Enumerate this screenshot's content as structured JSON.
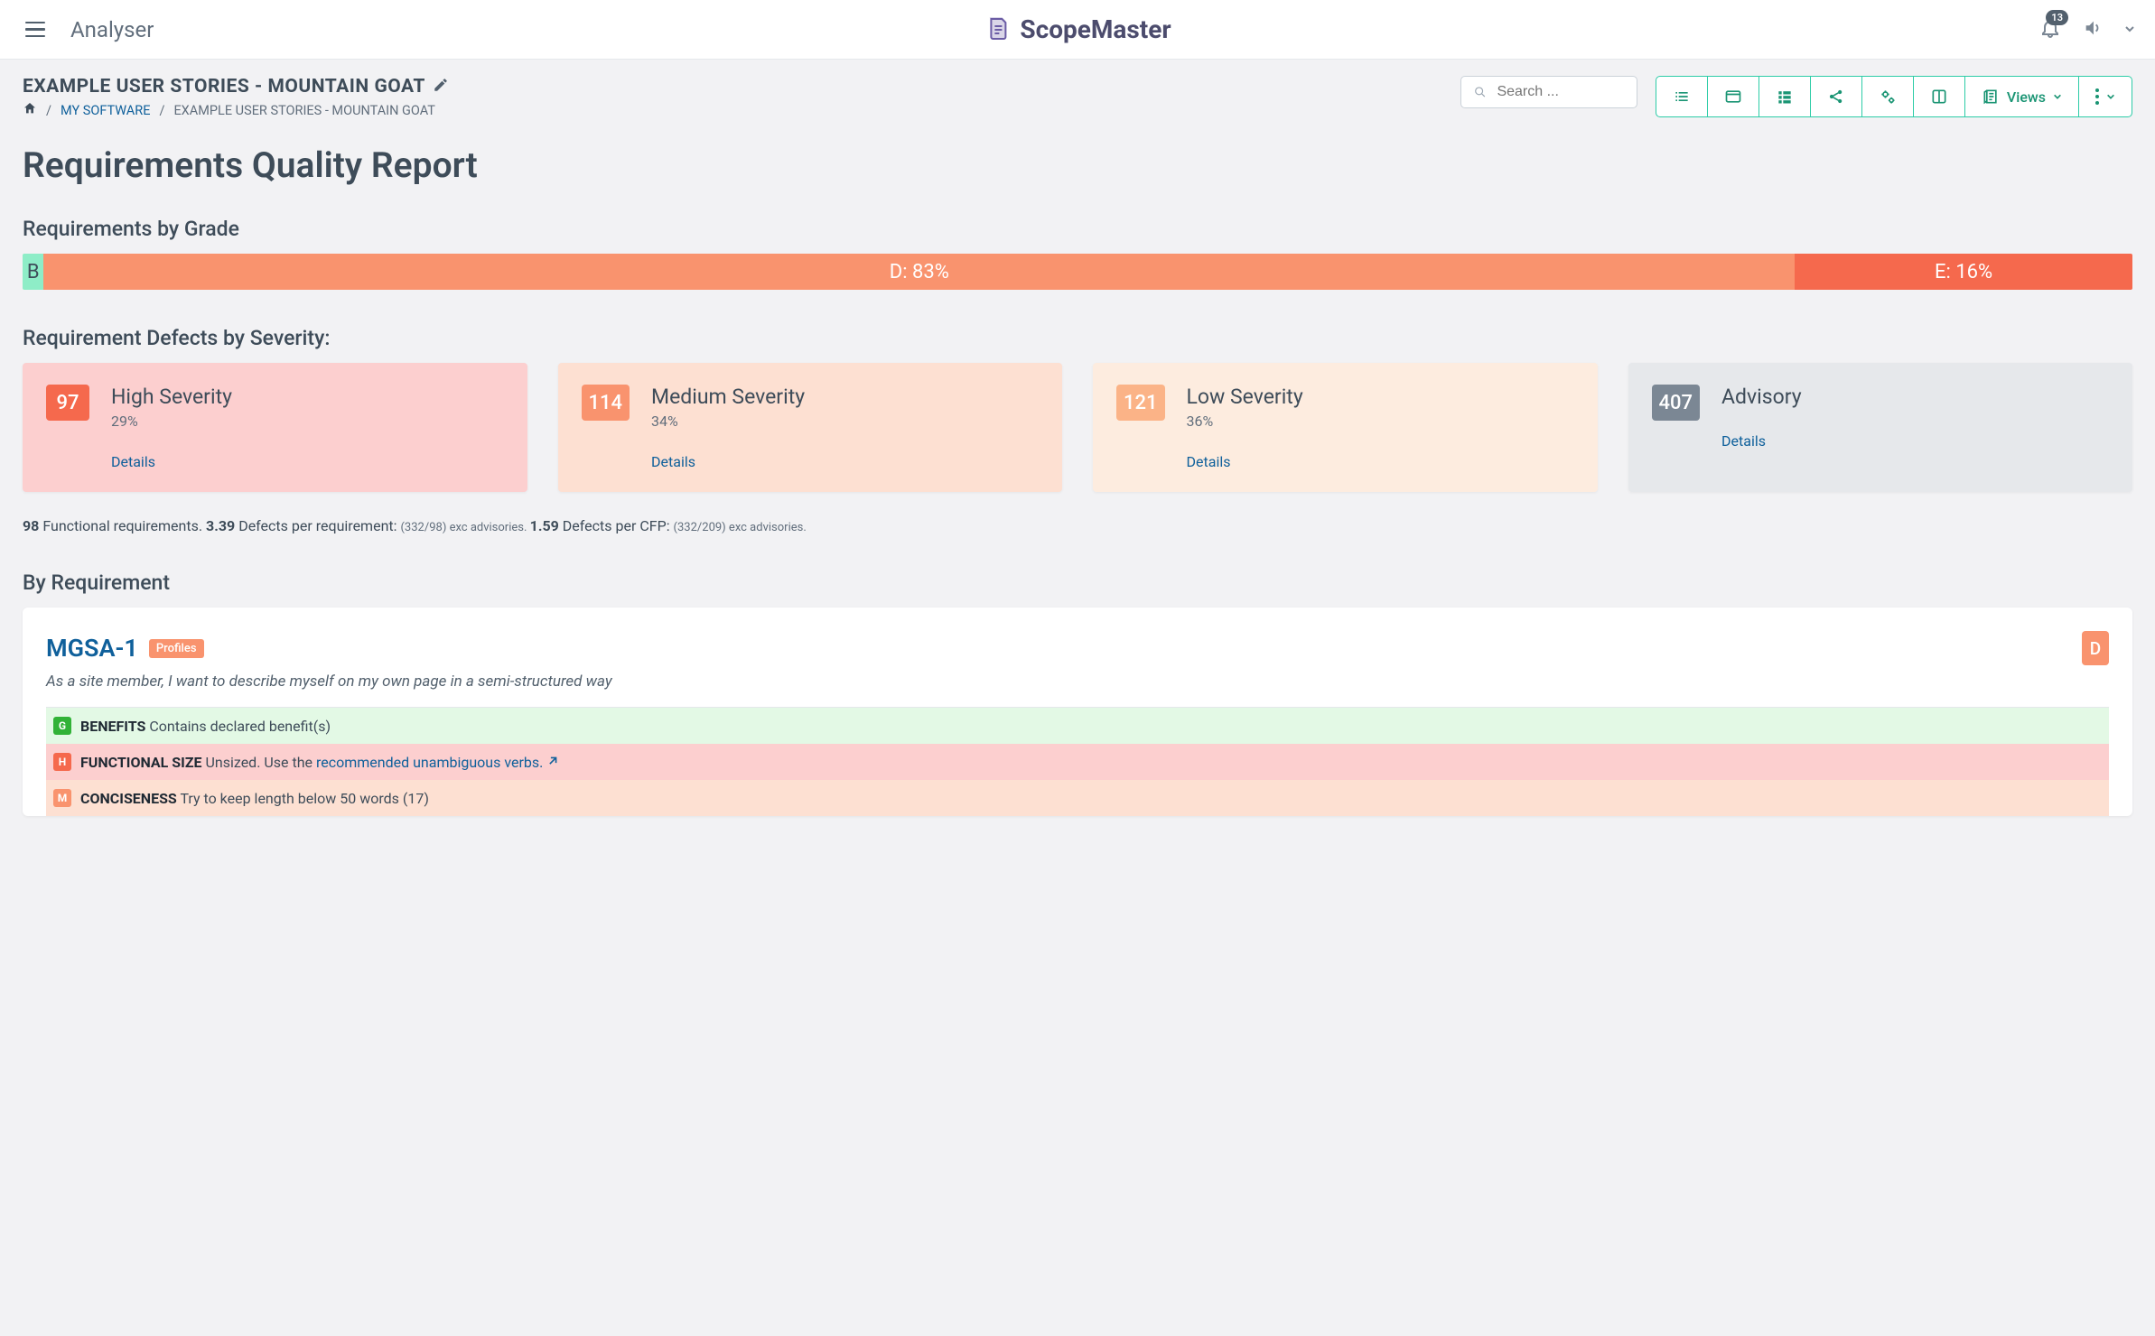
{
  "header": {
    "app_title": "Analyser",
    "brand": "ScopeMaster",
    "notifications": "13"
  },
  "page": {
    "project_title": "EXAMPLE USER STORIES - MOUNTAIN GOAT",
    "crumb_mysoftware": "MY SOFTWARE",
    "crumb_current": "EXAMPLE USER STORIES - MOUNTAIN GOAT",
    "search_placeholder": "Search ...",
    "views_label": "Views"
  },
  "report": {
    "title": "Requirements Quality Report",
    "grade_heading": "Requirements by Grade",
    "grade_bar": {
      "b": {
        "label": "B",
        "width": "1%",
        "color": "#8eedc7"
      },
      "d": {
        "label": "D: 83%",
        "width": "83%",
        "color": "#f9936e"
      },
      "e": {
        "label": "E: 16%",
        "width": "16%",
        "color": "#f5694d"
      }
    },
    "defects_heading": "Requirement Defects by Severity:",
    "severity": {
      "high": {
        "count": "97",
        "label": "High Severity",
        "pct": "29%",
        "details": "Details",
        "bg": "#fccfcf",
        "badge": "#f5694d"
      },
      "medium": {
        "count": "114",
        "label": "Medium Severity",
        "pct": "34%",
        "details": "Details",
        "bg": "#fde0d2",
        "badge": "#f9936e"
      },
      "low": {
        "count": "121",
        "label": "Low Severity",
        "pct": "36%",
        "details": "Details",
        "bg": "#fdecdf",
        "badge": "#fbb387"
      },
      "advisory": {
        "count": "407",
        "label": "Advisory",
        "pct": "",
        "details": "Details",
        "bg": "#e6e8eb",
        "badge": "#7b8794"
      }
    },
    "stats": {
      "func_count": "98",
      "func_label": " Functional requirements. ",
      "dpr_val": "3.39",
      "dpr_label": " Defects per requirement: ",
      "dpr_small": "(332/98) exc advisories. ",
      "dcfp_val": "1.59",
      "dcfp_label": " Defects per CFP: ",
      "dcfp_small": "(332/209) exc advisories."
    },
    "byreq_heading": "By Requirement"
  },
  "req1": {
    "id": "MGSA-1",
    "tag": "Profiles",
    "grade": "D",
    "story": "As a site member, I want to describe myself on my own page in a semi-structured way",
    "issues": {
      "g": {
        "badge": "G",
        "title": "BENEFITS",
        "text": " Contains declared benefit(s)",
        "row_bg": "#e3f9e5",
        "badge_bg": "#31b237"
      },
      "h": {
        "badge": "H",
        "title": "FUNCTIONAL SIZE",
        "text": " Unsized. Use the ",
        "link": "recommended unambiguous verbs.",
        "row_bg": "#fccfcf",
        "badge_bg": "#f5694d"
      },
      "m": {
        "badge": "M",
        "title": "CONCISENESS",
        "text": " Try to keep length below 50 words (17)",
        "row_bg": "#fde0d2",
        "badge_bg": "#f9936e"
      }
    }
  }
}
